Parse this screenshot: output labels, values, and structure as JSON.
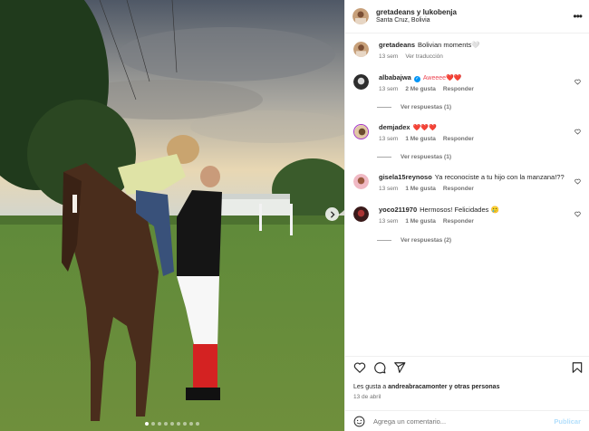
{
  "post": {
    "author": "gretadeans y lukobenja",
    "location": "Santa Cruz, Bolivia",
    "image_count": 9,
    "active_image": 0
  },
  "comments": [
    {
      "user": "gretadeans",
      "text": "Bolivian moments🤍",
      "time": "13 sem",
      "likes": "",
      "reply_label": "",
      "translate": "Ver traducción",
      "verified": false
    },
    {
      "user": "albabajwa",
      "text": "Aweeee❤️❤️",
      "time": "13 sem",
      "likes": "2 Me gusta",
      "reply_label": "Responder",
      "verified": true,
      "replies": "Ver respuestas (1)"
    },
    {
      "user": "demjadex",
      "text": "❤️❤️❤️",
      "time": "13 sem",
      "likes": "1 Me gusta",
      "reply_label": "Responder",
      "verified": false,
      "replies": "Ver respuestas (1)"
    },
    {
      "user": "gisela15reynoso",
      "text": "Ya reconociste a tu hijo con la manzana!??",
      "time": "13 sem",
      "likes": "1 Me gusta",
      "reply_label": "Responder",
      "verified": false
    },
    {
      "user": "yoco211970",
      "text": "Hermosos! Felicidades 🥲",
      "time": "13 sem",
      "likes": "1 Me gusta",
      "reply_label": "Responder",
      "verified": false,
      "replies": "Ver respuestas (2)"
    }
  ],
  "footer": {
    "likes_prefix": "Les gusta a ",
    "likes_user": "andreabracamonter",
    "likes_suffix": " y otras personas",
    "date": "13 de abril",
    "comment_placeholder": "Agrega un comentario...",
    "publish_label": "Publicar"
  },
  "icons": [
    "heart-icon",
    "comment-icon",
    "share-icon",
    "bookmark-icon",
    "emoji-icon",
    "more-icon",
    "chevron-right-icon"
  ],
  "colors": {
    "accent": "#0095f6",
    "heart": "#ed4956",
    "publish_disabled": "#b2dffc"
  }
}
